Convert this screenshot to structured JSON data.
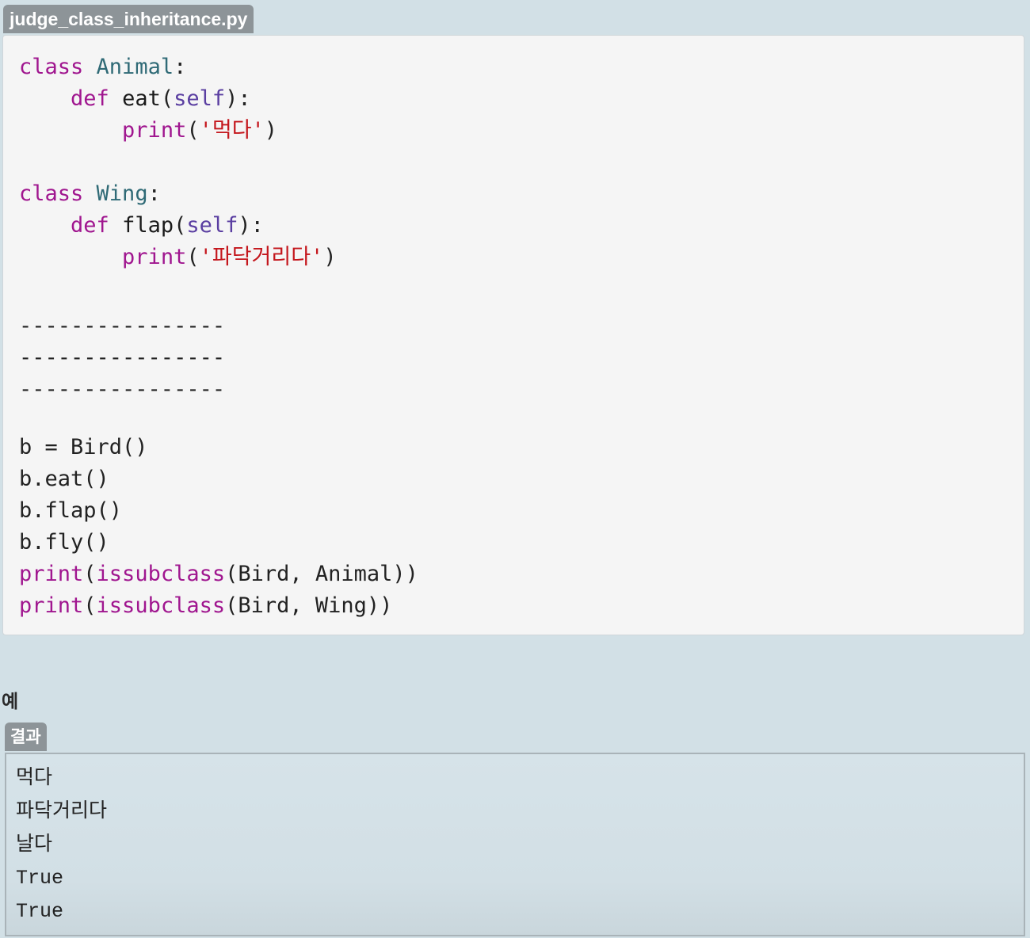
{
  "file": {
    "name": "judge_class_inheritance.py"
  },
  "code": {
    "line1": {
      "kw": "class",
      "name": "Animal",
      "colon": ":"
    },
    "line2": {
      "kw": "def",
      "fn": "eat",
      "open": "(",
      "self": "self",
      "close": "):"
    },
    "line3": {
      "fn": "print",
      "open": "(",
      "str": "'먹다'",
      "close": ")"
    },
    "line5": {
      "kw": "class",
      "name": "Wing",
      "colon": ":"
    },
    "line6": {
      "kw": "def",
      "fn": "flap",
      "open": "(",
      "self": "self",
      "close": "):"
    },
    "line7": {
      "fn": "print",
      "open": "(",
      "str": "'파닥거리다'",
      "close": ")"
    },
    "blank1": "----------------",
    "blank2": "----------------",
    "blank3": "----------------",
    "line13": "b = Bird()",
    "line14": "b.eat()",
    "line15": "b.flap()",
    "line16": "b.fly()",
    "line17": {
      "fn": "print",
      "open": "(",
      "fn2": "issubclass",
      "args": "(Bird, Animal))"
    },
    "line18": {
      "fn": "print",
      "open": "(",
      "fn2": "issubclass",
      "args": "(Bird, Wing))"
    }
  },
  "example_label": "예",
  "result": {
    "tab_label": "결과",
    "lines": [
      "먹다",
      "파닥거리다",
      "날다",
      "True",
      "True"
    ]
  },
  "colors": {
    "keyword": "#a0168f",
    "class_name": "#2f6a76",
    "self": "#5a3ea1",
    "string": "#c4161c",
    "background": "#d2e0e6",
    "code_background": "#f5f5f5",
    "tab_background": "#8d9498"
  }
}
